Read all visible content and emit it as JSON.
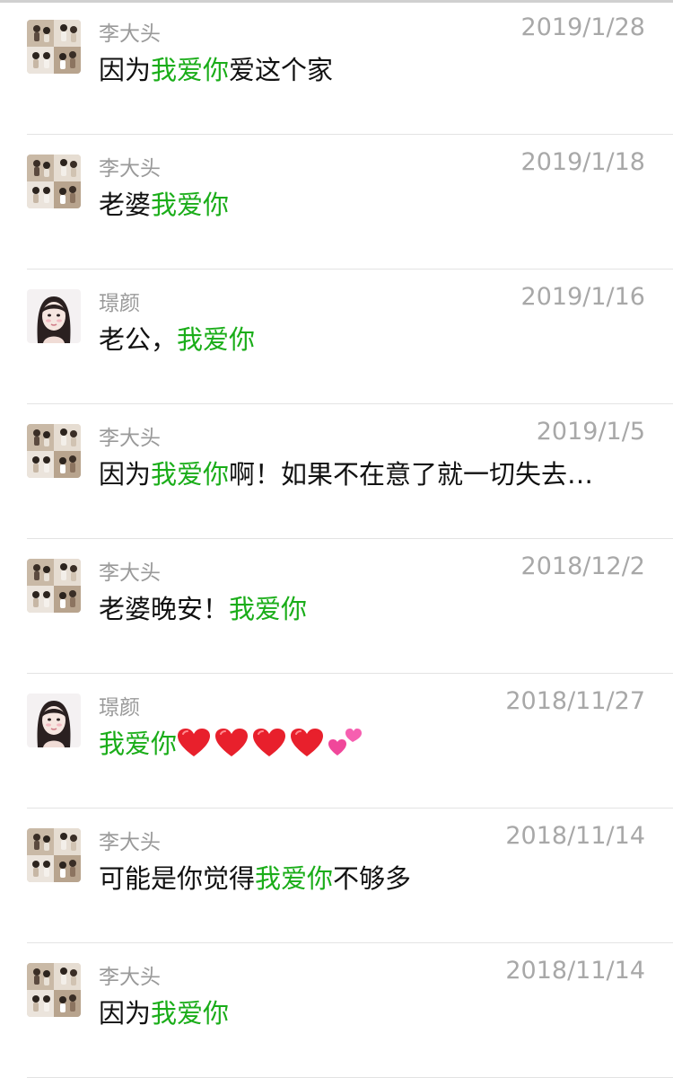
{
  "messages": [
    {
      "sender": "李大头",
      "avatar": "couple-photo-grid",
      "date": "2019/1/28",
      "parts": [
        {
          "t": "因为"
        },
        {
          "t": "我爱你",
          "hl": true
        },
        {
          "t": "爱这个家"
        }
      ]
    },
    {
      "sender": "李大头",
      "avatar": "couple-photo-grid",
      "date": "2019/1/18",
      "parts": [
        {
          "t": "老婆"
        },
        {
          "t": "我爱你",
          "hl": true
        }
      ]
    },
    {
      "sender": "璟颜",
      "avatar": "girl-selfie",
      "date": "2019/1/16",
      "parts": [
        {
          "t": "老公，"
        },
        {
          "t": "我爱你",
          "hl": true
        }
      ]
    },
    {
      "sender": "李大头",
      "avatar": "couple-photo-grid",
      "date": "2019/1/5",
      "parts": [
        {
          "t": "因为"
        },
        {
          "t": "我爱你",
          "hl": true
        },
        {
          "t": "啊！如果不在意了就一切失去…"
        }
      ]
    },
    {
      "sender": "李大头",
      "avatar": "couple-photo-grid",
      "date": "2018/12/2",
      "parts": [
        {
          "t": "老婆晚安！"
        },
        {
          "t": "我爱你",
          "hl": true
        }
      ]
    },
    {
      "sender": "璟颜",
      "avatar": "girl-selfie",
      "date": "2018/11/27",
      "parts": [
        {
          "t": "我爱你",
          "hl": true
        }
      ],
      "emoji": [
        "red-heart-icon",
        "red-heart-icon",
        "red-heart-icon",
        "red-heart-icon",
        "two-hearts-icon"
      ]
    },
    {
      "sender": "李大头",
      "avatar": "couple-photo-grid",
      "date": "2018/11/14",
      "parts": [
        {
          "t": "可能是你觉得"
        },
        {
          "t": "我爱你",
          "hl": true
        },
        {
          "t": "不够多"
        }
      ]
    },
    {
      "sender": "李大头",
      "avatar": "couple-photo-grid",
      "date": "2018/11/14",
      "parts": [
        {
          "t": "因为"
        },
        {
          "t": "我爱你",
          "hl": true
        }
      ]
    }
  ],
  "colors": {
    "highlight": "#1aad19",
    "text": "#111111",
    "meta": "#9a9a9a"
  }
}
